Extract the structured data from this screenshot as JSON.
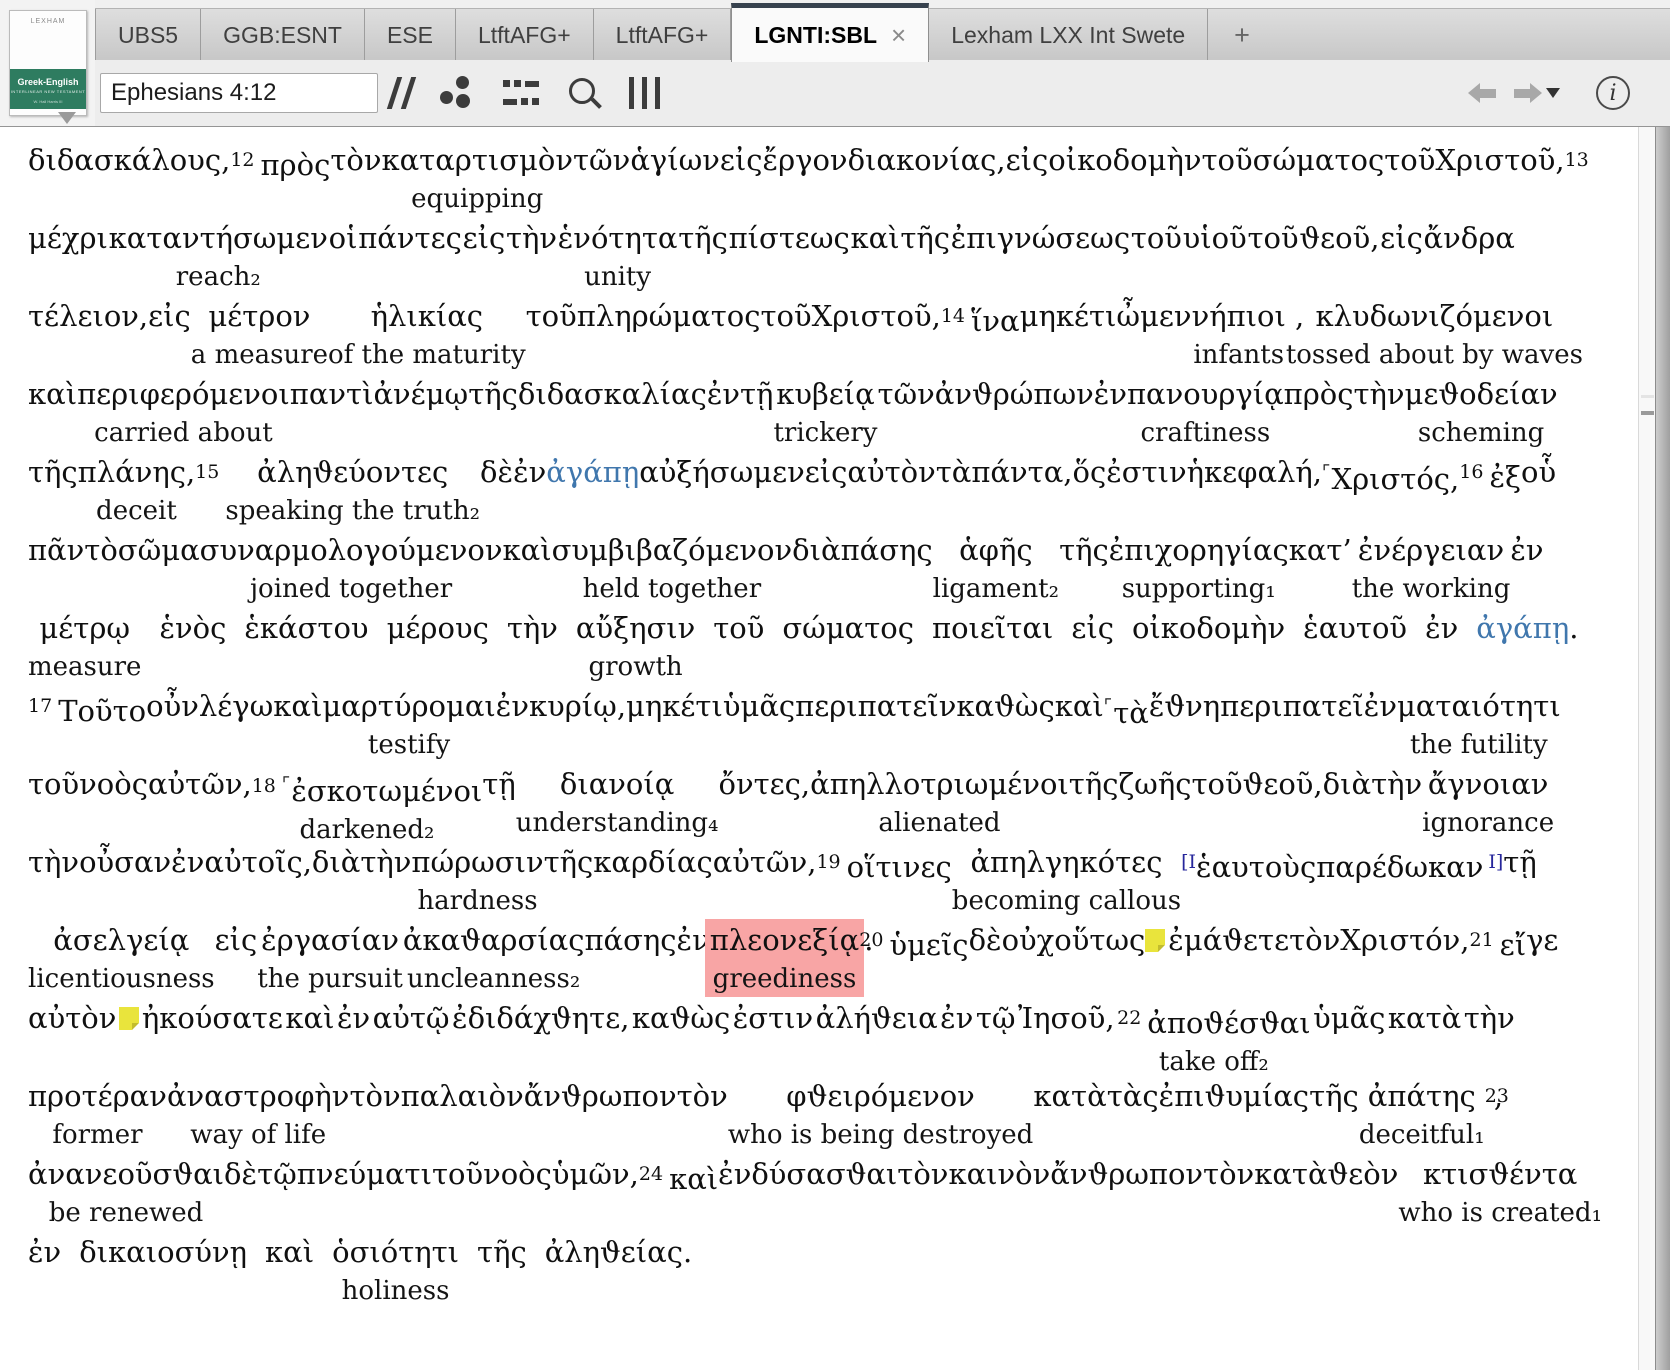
{
  "tabs": {
    "items": [
      {
        "label": "UBS5"
      },
      {
        "label": "GGB:ESNT"
      },
      {
        "label": "ESE"
      },
      {
        "label": "LtftAFG+"
      },
      {
        "label": "LtftAFG+"
      },
      {
        "label": "LGNTI:SBL",
        "active": true,
        "closable": true,
        "close_glyph": "×"
      },
      {
        "label": "Lexham LXX Int Swete"
      },
      {
        "label": "+",
        "plus": true
      }
    ]
  },
  "resource_panel": {
    "cover_top_text": "LEXHAM",
    "cover_title": "Greek-English",
    "cover_subtitle": "INTERLINEAR NEW TESTAMENT",
    "cover_note": "W. Hall Harris III"
  },
  "toolbar": {
    "reference": "Ephesians 4:12",
    "icons": [
      "parallel-passages",
      "visual-filters",
      "interlinear-display",
      "search",
      "columns"
    ],
    "nav_icons": [
      "back-arrow",
      "forward-arrow",
      "dropdown-arrow",
      "info"
    ]
  },
  "colors": {
    "link_blue": "#4077ad",
    "critical_navy": "#26269b",
    "highlight_pink": "#f8a5a5",
    "note_yellow": "#e9e43c",
    "active_tab_top": "#37424e"
  },
  "interlinear": {
    "lines": [
      {
        "justify": true,
        "units": [
          {
            "g": "διδασκάλους,"
          },
          {
            "v": "12",
            "g": "πρὸς"
          },
          {
            "g": "τὸν"
          },
          {
            "g": "καταρτισμὸν",
            "e": "equipping"
          },
          {
            "g": "τῶν"
          },
          {
            "g": "ἁγίων"
          },
          {
            "g": "εἰς"
          },
          {
            "g": "ἔργον"
          },
          {
            "g": "διακονίας,"
          },
          {
            "g": "εἰς"
          },
          {
            "g": "οἰκοδομὴν"
          },
          {
            "g": "τοῦ"
          },
          {
            "g": "σώματος"
          },
          {
            "g": "τοῦ"
          },
          {
            "g": "Χριστοῦ,"
          },
          {
            "v": "13",
            "g": ""
          }
        ]
      },
      {
        "justify": true,
        "units": [
          {
            "g": "μέχρι"
          },
          {
            "g": "καταντήσωμεν",
            "e": "reach₂"
          },
          {
            "g": "οἱ"
          },
          {
            "g": "πάντες"
          },
          {
            "g": "εἰς"
          },
          {
            "g": "τὴν"
          },
          {
            "g": "ἑνότητα",
            "e": "unity"
          },
          {
            "g": "τῆς"
          },
          {
            "g": "πίστεως"
          },
          {
            "g": "καὶ"
          },
          {
            "g": "τῆς"
          },
          {
            "g": "ἐπιγνώσεως"
          },
          {
            "g": "τοῦ"
          },
          {
            "g": "υἱοῦ"
          },
          {
            "g": "τοῦ"
          },
          {
            "g": "ϑεοῦ,"
          },
          {
            "g": "εἰς"
          },
          {
            "g": "ἄνδρα"
          }
        ]
      },
      {
        "justify": true,
        "units": [
          {
            "g": "τέλειον,"
          },
          {
            "g": "εἰς"
          },
          {
            "g": "μέτρον",
            "e": "a measure"
          },
          {
            "g": "ἡλικίας",
            "e": "of the maturity"
          },
          {
            "g": "τοῦ"
          },
          {
            "g": "πληρώματος"
          },
          {
            "g": "τοῦ"
          },
          {
            "g": "Χριστοῦ,"
          },
          {
            "v": "14",
            "g": "ἵνα"
          },
          {
            "g": "μηκέτι"
          },
          {
            "g": "ὦμεν"
          },
          {
            "g": "νήπιοι",
            "e": "infants",
            "tail": " ,"
          },
          {
            "g": "κλυδωνιζόμενοι",
            "e": "tossed about by waves"
          }
        ]
      },
      {
        "justify": true,
        "units": [
          {
            "g": "καὶ"
          },
          {
            "g": "περιφερόμενοι",
            "e": "carried about"
          },
          {
            "g": "παντὶ"
          },
          {
            "g": "ἀνέμῳ"
          },
          {
            "g": "τῆς"
          },
          {
            "g": "διδασκαλίας"
          },
          {
            "g": "ἐν"
          },
          {
            "g": "τῇ"
          },
          {
            "g": "κυβείᾳ",
            "e": "trickery"
          },
          {
            "g": "τῶν"
          },
          {
            "g": "ἀνϑρώπων"
          },
          {
            "g": "ἐν"
          },
          {
            "g": "πανουργίᾳ",
            "e": "craftiness"
          },
          {
            "g": "πρὸς"
          },
          {
            "g": "τὴν"
          },
          {
            "g": "μεϑοδείαν",
            "e": "scheming"
          }
        ]
      },
      {
        "justify": true,
        "units": [
          {
            "g": "τῆς"
          },
          {
            "g": "πλάνης,",
            "e": "deceit"
          },
          {
            "v": "15",
            "g": ""
          },
          {
            "g": "ἀληϑεύοντες",
            "e": "speaking the truth₂"
          },
          {
            "g": "δὲ"
          },
          {
            "g": "ἐν"
          },
          {
            "g": "ἀγάπῃ",
            "blue": true
          },
          {
            "g": "αὐξήσωμεν"
          },
          {
            "g": "εἰς"
          },
          {
            "g": "αὐτὸν"
          },
          {
            "g": "τὰ"
          },
          {
            "g": "πάντα,"
          },
          {
            "g": "ὅς"
          },
          {
            "g": "ἐστιν"
          },
          {
            "g": "ἡ"
          },
          {
            "g": "κεφαλή,"
          },
          {
            "pre": "⌜",
            "g": "Χριστός,"
          },
          {
            "v": "16",
            "g": "ἐξ"
          },
          {
            "g": "οὗ"
          }
        ]
      },
      {
        "justify": true,
        "units": [
          {
            "g": "πᾶν"
          },
          {
            "g": "τὸ"
          },
          {
            "g": "σῶμα"
          },
          {
            "g": "συναρμολογούμενον",
            "e": "joined together"
          },
          {
            "g": "καὶ"
          },
          {
            "g": "συμβιβαζόμενον",
            "e": "held together"
          },
          {
            "g": "διὰ"
          },
          {
            "g": "πάσης"
          },
          {
            "g": "ἁφῆς",
            "e": "ligament₂"
          },
          {
            "g": "τῆς"
          },
          {
            "g": "ἐπιχορηγίας",
            "e": "supporting₁"
          },
          {
            "g": "κατ’"
          },
          {
            "g": "ἐνέργειαν",
            "e": "the working"
          },
          {
            "g": "ἐν"
          }
        ]
      },
      {
        "justify": false,
        "units": [
          {
            "g": "μέτρῳ",
            "e": "measure"
          },
          {
            "g": "ἑνὸς"
          },
          {
            "g": "ἑκάστου"
          },
          {
            "g": "μέρους"
          },
          {
            "g": "τὴν"
          },
          {
            "g": "αὔξησιν",
            "e": "growth"
          },
          {
            "g": "τοῦ"
          },
          {
            "g": "σώματος"
          },
          {
            "g": "ποιεῖται"
          },
          {
            "g": "εἰς"
          },
          {
            "g": "οἰκοδομὴν"
          },
          {
            "g": "ἑαυτοῦ"
          },
          {
            "g": "ἐν"
          },
          {
            "g": "ἀγάπῃ",
            "blue": true,
            "tail": "."
          }
        ]
      },
      {
        "justify": true,
        "units": [
          {
            "v": "17",
            "g": "Τοῦτο"
          },
          {
            "g": "οὖν"
          },
          {
            "g": "λέγω"
          },
          {
            "g": "καὶ"
          },
          {
            "g": "μαρτύρομαι",
            "e": "testify"
          },
          {
            "g": "ἐν"
          },
          {
            "g": "κυρίῳ,"
          },
          {
            "g": "μηκέτι"
          },
          {
            "g": "ὑμᾶς"
          },
          {
            "g": "περιπατεῖν"
          },
          {
            "g": "καϑὼς"
          },
          {
            "g": "καὶ"
          },
          {
            "pre": "⌜",
            "g": "τὰ"
          },
          {
            "g": "ἔϑνη"
          },
          {
            "g": "περιπατεῖ"
          },
          {
            "g": "ἐν"
          },
          {
            "g": "ματαιότητι",
            "e": "the futility"
          }
        ]
      },
      {
        "justify": true,
        "units": [
          {
            "g": "τοῦ"
          },
          {
            "g": "νοὸς"
          },
          {
            "g": "αὐτῶν,"
          },
          {
            "v": "18",
            "pre": "⌜",
            "g": "ἐσκοτωμένοι",
            "e": "darkened₂"
          },
          {
            "g": "τῇ"
          },
          {
            "g": "διανοίᾳ",
            "e": "understanding₄"
          },
          {
            "g": "ὄντες,"
          },
          {
            "g": "ἀπηλλοτριωμένοι",
            "e": "alienated"
          },
          {
            "g": "τῆς"
          },
          {
            "g": "ζωῆς"
          },
          {
            "g": "τοῦ"
          },
          {
            "g": "ϑεοῦ,"
          },
          {
            "g": "διὰ"
          },
          {
            "g": "τὴν"
          },
          {
            "g": "ἄγνοιαν",
            "e": "ignorance"
          }
        ]
      },
      {
        "justify": true,
        "units": [
          {
            "g": "τὴν"
          },
          {
            "g": "οὖσαν"
          },
          {
            "g": "ἐν"
          },
          {
            "g": "αὐτοῖς,"
          },
          {
            "g": "διὰ"
          },
          {
            "g": "τὴν"
          },
          {
            "g": "πώρωσιν",
            "e": "hardness"
          },
          {
            "g": "τῆς"
          },
          {
            "g": "καρδίας"
          },
          {
            "g": "αὐτῶν,"
          },
          {
            "v": "19",
            "g": "οἵτινες"
          },
          {
            "g": "ἀπηλγηκότες",
            "e": "becoming callous"
          },
          {
            "pre": "[I",
            "g": "ἑαυτοὺς"
          },
          {
            "g": "παρέδωκαν",
            "post": "I]"
          },
          {
            "g": "τῇ"
          }
        ]
      },
      {
        "justify": true,
        "units": [
          {
            "g": "ἀσελγείᾳ",
            "e": "licentiousness"
          },
          {
            "g": "εἰς"
          },
          {
            "g": "ἐργασίαν",
            "e": "the pursuit"
          },
          {
            "g": "ἀκαϑαρσίας",
            "e": "uncleanness₂"
          },
          {
            "g": "πάσης"
          },
          {
            "g": "ἐν"
          },
          {
            "g": "πλεονεξίᾳ",
            "e": "greediness",
            "hl": true,
            "tail": "."
          },
          {
            "v": "20",
            "g": "ὑμεῖς"
          },
          {
            "g": "δὲ"
          },
          {
            "g": "οὐχ"
          },
          {
            "g": "οὕτως"
          },
          {
            "note": true,
            "g": "ἐμάϑετε"
          },
          {
            "g": "τὸν"
          },
          {
            "g": "Χριστόν,"
          },
          {
            "v": "21",
            "g": "εἴ"
          },
          {
            "g": "γε"
          }
        ]
      },
      {
        "justify": true,
        "units": [
          {
            "g": "αὐτὸν"
          },
          {
            "note": true,
            "g": "ἠκούσατε"
          },
          {
            "g": "καὶ"
          },
          {
            "g": "ἐν"
          },
          {
            "g": "αὐτῷ"
          },
          {
            "g": "ἐδιδάχϑητε,"
          },
          {
            "g": "καϑὼς"
          },
          {
            "g": "ἐστιν"
          },
          {
            "g": "ἀλήϑεια"
          },
          {
            "g": "ἐν"
          },
          {
            "g": "τῷ"
          },
          {
            "g": "Ἰησοῦ,"
          },
          {
            "v": "22",
            "g": "ἀποϑέσϑαι",
            "e": "take off₂"
          },
          {
            "g": "ὑμᾶς"
          },
          {
            "g": "κατὰ"
          },
          {
            "g": "τὴν"
          }
        ]
      },
      {
        "justify": true,
        "units": [
          {
            "g": "προτέραν",
            "e": "former"
          },
          {
            "g": "ἀναστροφὴν",
            "e": "way of life"
          },
          {
            "g": "τὸν"
          },
          {
            "g": "παλαιὸν"
          },
          {
            "g": "ἄνϑρωπον"
          },
          {
            "g": "τὸν"
          },
          {
            "g": "φϑειρόμενον",
            "e": "who is being destroyed"
          },
          {
            "g": "κατὰ"
          },
          {
            "g": "τὰς"
          },
          {
            "g": "ἐπιϑυμίας"
          },
          {
            "g": "τῆς"
          },
          {
            "g": "ἀπάτης",
            "e": "deceitful₁",
            "tail": " ,"
          },
          {
            "v": "23",
            "g": ""
          }
        ]
      },
      {
        "justify": true,
        "units": [
          {
            "g": "ἀνανεοῦσϑαι",
            "e": "be renewed"
          },
          {
            "g": "δὲ"
          },
          {
            "g": "τῷ"
          },
          {
            "g": "πνεύματι"
          },
          {
            "g": "τοῦ"
          },
          {
            "g": "νοὸς"
          },
          {
            "g": "ὑμῶν,"
          },
          {
            "v": "24",
            "g": "καὶ"
          },
          {
            "g": "ἐνδύσασϑαι"
          },
          {
            "g": "τὸν"
          },
          {
            "g": "καινὸν"
          },
          {
            "g": "ἄνϑρωπον"
          },
          {
            "g": "τὸν"
          },
          {
            "g": "κατὰ"
          },
          {
            "g": "ϑεὸν"
          },
          {
            "g": "κτισϑέντα",
            "e": "who is created₁"
          }
        ]
      },
      {
        "justify": false,
        "units": [
          {
            "g": "ἐν"
          },
          {
            "g": "δικαιοσύνῃ"
          },
          {
            "g": "καὶ"
          },
          {
            "g": "ὁσιότητι",
            "e": "holiness"
          },
          {
            "g": "τῆς"
          },
          {
            "g": "ἀληϑείας."
          }
        ]
      }
    ]
  }
}
